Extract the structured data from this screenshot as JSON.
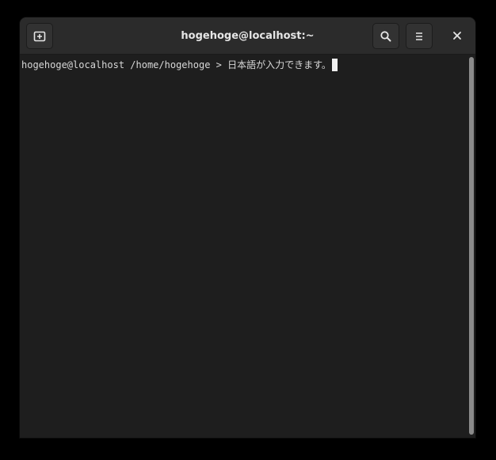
{
  "window": {
    "title": "hogehoge@localhost:~"
  },
  "toolbar": {
    "new_tab_icon": "new-tab-icon",
    "search_icon": "search-icon",
    "menu_icon": "hamburger-menu-icon",
    "close_icon": "close-icon"
  },
  "terminal": {
    "prompt": "hogehoge@localhost /home/hogehoge > ",
    "input": "日本語が入力できます。"
  },
  "colors": {
    "background": "#1e1e1e",
    "headerbar": "#2b2b2b",
    "text": "#d8d8d8",
    "cursor": "#f0f0f0"
  }
}
